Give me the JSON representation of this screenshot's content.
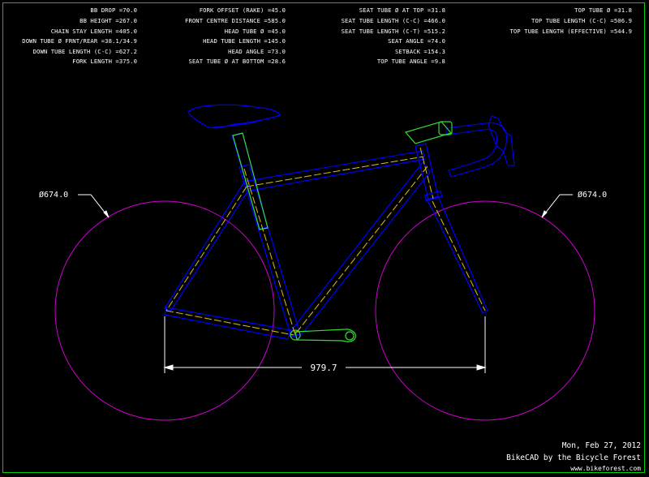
{
  "specs": {
    "col1": [
      {
        "label": "BB DROP",
        "value": "70.0"
      },
      {
        "label": "BB HEIGHT",
        "value": "267.0"
      },
      {
        "label": "CHAIN STAY LENGTH",
        "value": "405.0"
      },
      {
        "label": "DOWN TUBE Ø FRNT/REAR",
        "value": "38.1/34.9"
      },
      {
        "label": "DOWN TUBE LENGTH (C-C)",
        "value": "627.2"
      },
      {
        "label": "FORK LENGTH",
        "value": "375.0"
      }
    ],
    "col2": [
      {
        "label": "FORK OFFSET (RAKE)",
        "value": "45.0"
      },
      {
        "label": "FRONT CENTRE DISTANCE",
        "value": "585.0"
      },
      {
        "label": "HEAD TUBE Ø",
        "value": "45.0"
      },
      {
        "label": "HEAD TUBE LENGTH",
        "value": "145.0"
      },
      {
        "label": "HEAD ANGLE",
        "value": "73.0"
      },
      {
        "label": "SEAT TUBE Ø AT BOTTOM",
        "value": "28.6"
      }
    ],
    "col3": [
      {
        "label": "SEAT TUBE Ø AT TOP",
        "value": "31.8"
      },
      {
        "label": "SEAT TUBE LENGTH (C-C)",
        "value": "466.0"
      },
      {
        "label": "SEAT TUBE LENGTH (C-T)",
        "value": "515.2"
      },
      {
        "label": "SEAT ANGLE",
        "value": "74.0"
      },
      {
        "label": "SETBACK",
        "value": "154.3"
      },
      {
        "label": "TOP TUBE ANGLE",
        "value": "9.8"
      }
    ],
    "col4": [
      {
        "label": "TOP TUBE Ø",
        "value": "31.8"
      },
      {
        "label": "TOP TUBE LENGTH (C-C)",
        "value": "506.9"
      },
      {
        "label": "TOP TUBE LENGTH (EFFECTIVE)",
        "value": "544.9"
      }
    ]
  },
  "dimensions": {
    "rear_wheel_diameter": "Ø674.0",
    "front_wheel_diameter": "Ø674.0",
    "wheelbase": "979.7"
  },
  "footer": {
    "date": "Mon, Feb 27, 2012",
    "credit": "BikeCAD by the Bicycle Forest",
    "url": "www.bikeforest.com"
  },
  "colors": {
    "background": "#000000",
    "border": "#00cc00",
    "frame": "#0000ff",
    "centerline": "#e0c000",
    "wheel": "#cc00cc",
    "component": "#33dd33",
    "text": "#ffffff"
  }
}
